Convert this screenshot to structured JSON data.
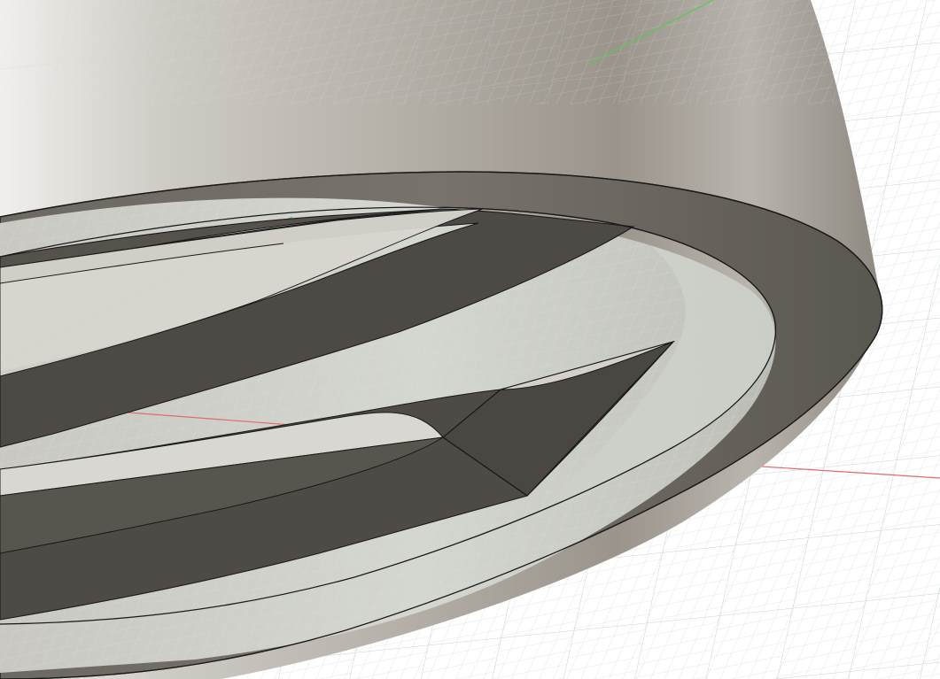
{
  "viewport": {
    "background_color": "#ffffff",
    "grid_minor_color": "#dde1e6",
    "grid_major_color": "#c7ccd3",
    "x_axis_color": "#e36a6a",
    "y_axis_color": "#57c957",
    "body_color": "#b7b2aa",
    "edge_color": "#1a1a1a"
  },
  "scene": {
    "model_type": "cylindrical shell with curved slotted cut-outs",
    "visible_parts": [
      "outer-wall",
      "top-rim-face",
      "inner-wall",
      "curved-fin-upper",
      "curved-fin-lower",
      "fin-end-wedge"
    ]
  }
}
